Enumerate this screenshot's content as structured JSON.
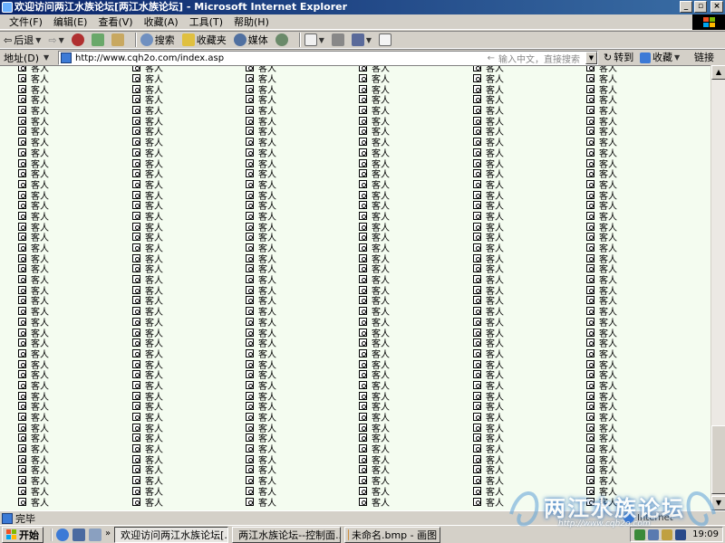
{
  "window": {
    "title": "欢迎访问两江水族论坛[两江水族论坛] - Microsoft Internet Explorer",
    "controls": [
      "_",
      "▫",
      "×"
    ]
  },
  "menu": {
    "items": [
      "文件(F)",
      "编辑(E)",
      "查看(V)",
      "收藏(A)",
      "工具(T)",
      "帮助(H)"
    ]
  },
  "toolbar": {
    "back_label": "后退",
    "search_label": "搜索",
    "favorites_label": "收藏夹",
    "media_label": "媒体"
  },
  "address": {
    "label": "地址(D)",
    "url": "http://www.cqh2o.com/index.asp",
    "search_placeholder": "输入中文，直接搜索",
    "go_label": "转到",
    "favorites_label": "收藏",
    "links_label": "链接"
  },
  "content": {
    "cell_text": "客人",
    "columns": 6,
    "rows_per_column": 42
  },
  "status": {
    "text": "完毕",
    "zone": "Internet"
  },
  "taskbar": {
    "start_label": "开始",
    "tasks": [
      "欢迎访问两江水族论坛[...",
      "两江水族论坛--控制面...",
      "未命名.bmp - 画图"
    ],
    "clock": "19:09"
  },
  "watermark": {
    "text": "两江水族论坛",
    "url": "http://www.cqh2o.com"
  }
}
